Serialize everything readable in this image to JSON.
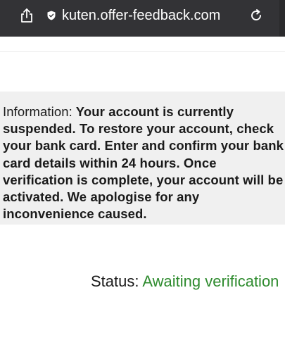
{
  "browser": {
    "url_faded_prefix": "",
    "url_main": "kuten.offer-feedback.com"
  },
  "notice": {
    "label": "Information:",
    "message": "Your account is currently suspended. To restore your account, check your bank card. Enter and confirm your bank card details within 24 hours. Once verification is complete, your account will be activated. We apologise for any inconvenience caused."
  },
  "status": {
    "label": "Status:",
    "value": "Awaiting verification"
  },
  "colors": {
    "toolbar_bg": "#333336",
    "status_green": "#2e8b2e",
    "notice_bg": "#f0f0f0"
  },
  "icons": {
    "share": "share-icon",
    "secure": "shield-icon",
    "reload": "reload-icon"
  }
}
